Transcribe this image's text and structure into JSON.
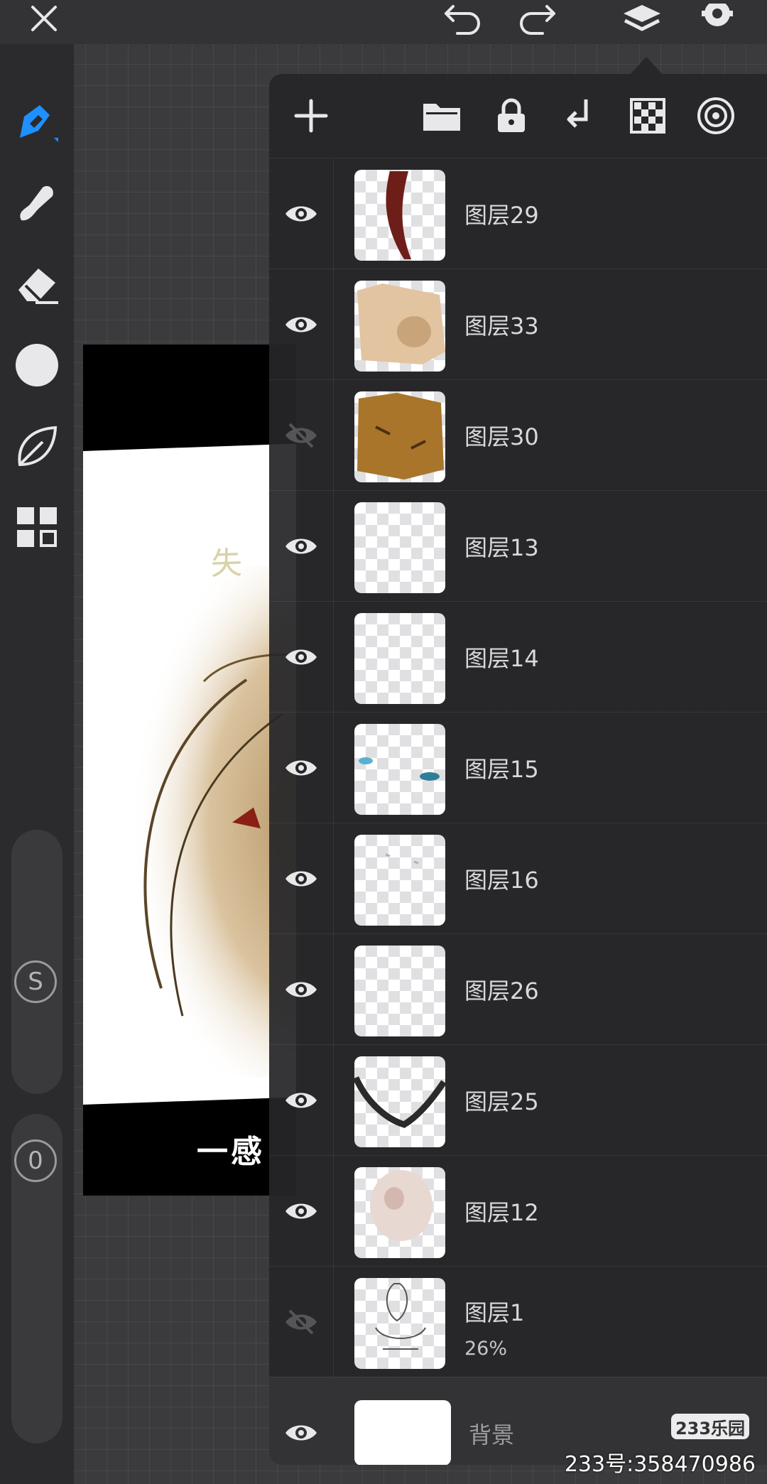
{
  "colors": {
    "accent": "#1e90ff",
    "icon": "#e8e8ea",
    "panel": "#262629"
  },
  "topbar": {
    "icons": [
      "close-icon",
      "undo-icon",
      "redo-icon",
      "layers-icon",
      "gear-icon"
    ]
  },
  "left_tools": {
    "icons": [
      "pen-icon",
      "smudge-icon",
      "eraser-icon",
      "color-swatch-icon",
      "leaf-icon",
      "gallery-grid-icon"
    ],
    "size_slider_label": "S",
    "opacity_slider_label": "0"
  },
  "artwork": {
    "caption": "一感"
  },
  "layer_toolbar": {
    "icons": [
      "plus-icon",
      "folder-icon",
      "lock-icon",
      "merge-down-icon",
      "checker-icon",
      "target-icon"
    ]
  },
  "layers": [
    {
      "name": "图层29",
      "visible": true
    },
    {
      "name": "图层33",
      "visible": true
    },
    {
      "name": "图层30",
      "visible": false
    },
    {
      "name": "图层13",
      "visible": true
    },
    {
      "name": "图层14",
      "visible": true
    },
    {
      "name": "图层15",
      "visible": true
    },
    {
      "name": "图层16",
      "visible": true
    },
    {
      "name": "图层26",
      "visible": true
    },
    {
      "name": "图层25",
      "visible": true
    },
    {
      "name": "图层12",
      "visible": true
    },
    {
      "name": "图层1",
      "visible": false,
      "opacity": "26%"
    }
  ],
  "background_layer": {
    "name": "背景",
    "visible": true
  },
  "watermark": {
    "logo": "233乐园",
    "id_text": "233号:358470986"
  }
}
